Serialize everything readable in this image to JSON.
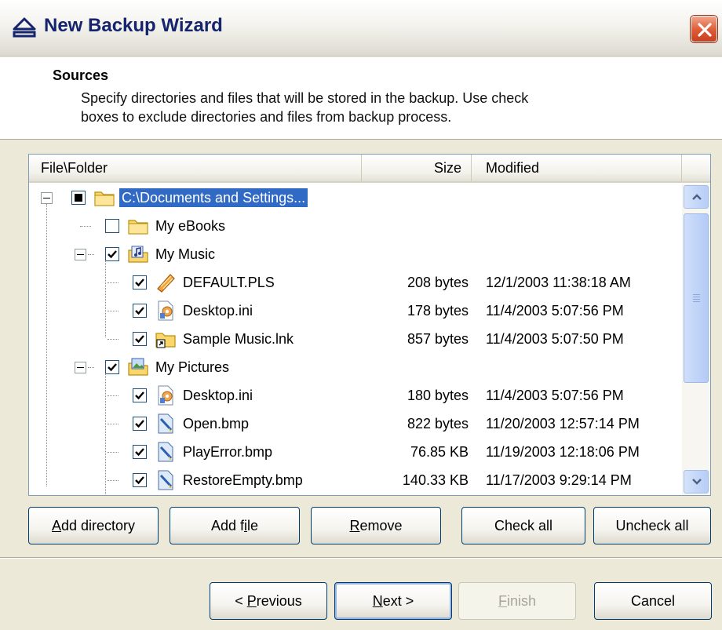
{
  "window": {
    "title": "New Backup Wizard",
    "close_icon": "close-icon"
  },
  "header": {
    "title": "Sources",
    "description_line1": "Specify directories and files that will be stored in the backup. Use check",
    "description_line2": "boxes to exclude directories and files from backup process."
  },
  "list": {
    "columns": [
      "File\\Folder",
      "Size",
      "Modified"
    ],
    "rows": [
      {
        "name": "C:\\Documents and Settings...",
        "size": "",
        "modified": "",
        "check": "partial",
        "icon": "folder-icon",
        "level": 0,
        "expander": true,
        "selected": true
      },
      {
        "name": "My eBooks",
        "size": "",
        "modified": "",
        "check": "unchecked",
        "icon": "folder-icon",
        "level": 1,
        "expander": false,
        "selected": false
      },
      {
        "name": "My Music",
        "size": "",
        "modified": "",
        "check": "checked",
        "icon": "music-folder-icon",
        "level": 1,
        "expander": true,
        "selected": false
      },
      {
        "name": "DEFAULT.PLS",
        "size": "208 bytes",
        "modified": "12/1/2003 11:38:18 AM",
        "check": "checked",
        "icon": "playlist-icon",
        "level": 2,
        "expander": false,
        "selected": false
      },
      {
        "name": "Desktop.ini",
        "size": "178 bytes",
        "modified": "11/4/2003 5:07:56 PM",
        "check": "checked",
        "icon": "settings-file-icon",
        "level": 2,
        "expander": false,
        "selected": false
      },
      {
        "name": "Sample Music.lnk",
        "size": "857 bytes",
        "modified": "11/4/2003 5:07:50 PM",
        "check": "checked",
        "icon": "shortcut-icon",
        "level": 2,
        "expander": false,
        "selected": false
      },
      {
        "name": "My Pictures",
        "size": "",
        "modified": "",
        "check": "checked",
        "icon": "pictures-folder-icon",
        "level": 1,
        "expander": true,
        "selected": false
      },
      {
        "name": "Desktop.ini",
        "size": "180 bytes",
        "modified": "11/4/2003 5:07:56 PM",
        "check": "checked",
        "icon": "settings-file-icon",
        "level": 2,
        "expander": false,
        "selected": false
      },
      {
        "name": "Open.bmp",
        "size": "822 bytes",
        "modified": "11/20/2003 12:57:14 PM",
        "check": "checked",
        "icon": "bitmap-icon",
        "level": 2,
        "expander": false,
        "selected": false
      },
      {
        "name": "PlayError.bmp",
        "size": "76.85 KB",
        "modified": "11/19/2003 12:18:06 PM",
        "check": "checked",
        "icon": "bitmap-icon",
        "level": 2,
        "expander": false,
        "selected": false
      },
      {
        "name": "RestoreEmpty.bmp",
        "size": "140.33 KB",
        "modified": "11/17/2003 9:29:14 PM",
        "check": "checked",
        "icon": "bitmap-icon",
        "level": 2,
        "expander": false,
        "selected": false
      }
    ]
  },
  "actions": {
    "add_directory": {
      "pre": "",
      "u": "A",
      "post": "dd directory"
    },
    "add_file": {
      "pre": "Add f",
      "u": "i",
      "post": "le"
    },
    "remove": {
      "pre": "",
      "u": "R",
      "post": "emove"
    },
    "check_all": "Check all",
    "uncheck_all": "Uncheck all"
  },
  "nav": {
    "previous": {
      "pre": "< ",
      "u": "P",
      "post": "revious"
    },
    "next": {
      "pre": "",
      "u": "N",
      "post": "ext >"
    },
    "finish": {
      "pre": "",
      "u": "F",
      "post": "inish"
    },
    "cancel": "Cancel"
  },
  "colors": {
    "selection": "#316ac5",
    "title_text": "#14256e",
    "close_button": "#de5a34",
    "scrollbar": "#b7cdf6"
  }
}
